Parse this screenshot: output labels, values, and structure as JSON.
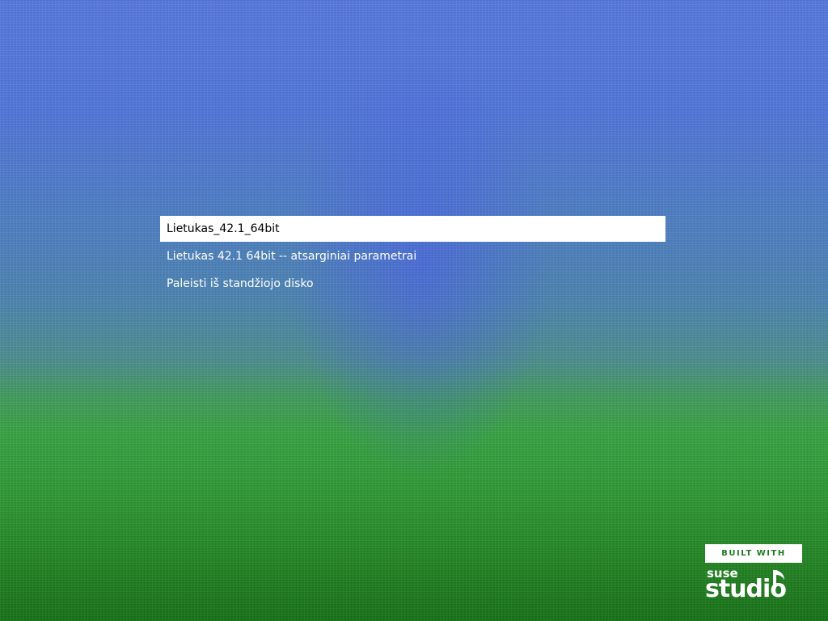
{
  "boot_menu": {
    "items": [
      {
        "label": "Lietukas_42.1_64bit",
        "selected": true
      },
      {
        "label": "Lietukas 42.1 64bit -- atsarginiai parametrai",
        "selected": false
      },
      {
        "label": "Paleisti iš standžiojo disko",
        "selected": false
      }
    ]
  },
  "branding": {
    "built_with": "BUILT WITH",
    "brand_line1": "suse",
    "brand_line2": "studio",
    "icon": "music-note-icon"
  },
  "colors": {
    "sky_blue": "#5577dd",
    "field_green": "#1e7f1e",
    "badge_green": "#1f7a1f",
    "selection_bg": "#ffffff"
  }
}
